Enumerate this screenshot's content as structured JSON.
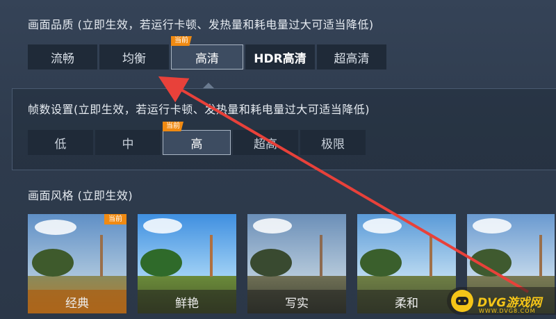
{
  "quality": {
    "title": "画面品质 (立即生效，若运行卡顿、发热量和耗电量过大可适当降低)",
    "options": [
      "流畅",
      "均衡",
      "高清",
      "HDR高清",
      "超高清"
    ],
    "current_badge": "当前"
  },
  "framerate": {
    "title": "帧数设置(立即生效，若运行卡顿、发热量和耗电量过大可适当降低)",
    "options": [
      "低",
      "中",
      "高",
      "超高",
      "极限"
    ],
    "current_badge": "当前"
  },
  "style": {
    "title": "画面风格 (立即生效)",
    "cards": [
      "经典",
      "鲜艳",
      "写实",
      "柔和",
      ""
    ],
    "current_badge": "当前"
  },
  "watermark": {
    "text": "DVG游戏网",
    "sub": "WWW.DVG8.COM"
  },
  "colors": {
    "accent": "#f08a12",
    "arrow": "#e8413a"
  }
}
